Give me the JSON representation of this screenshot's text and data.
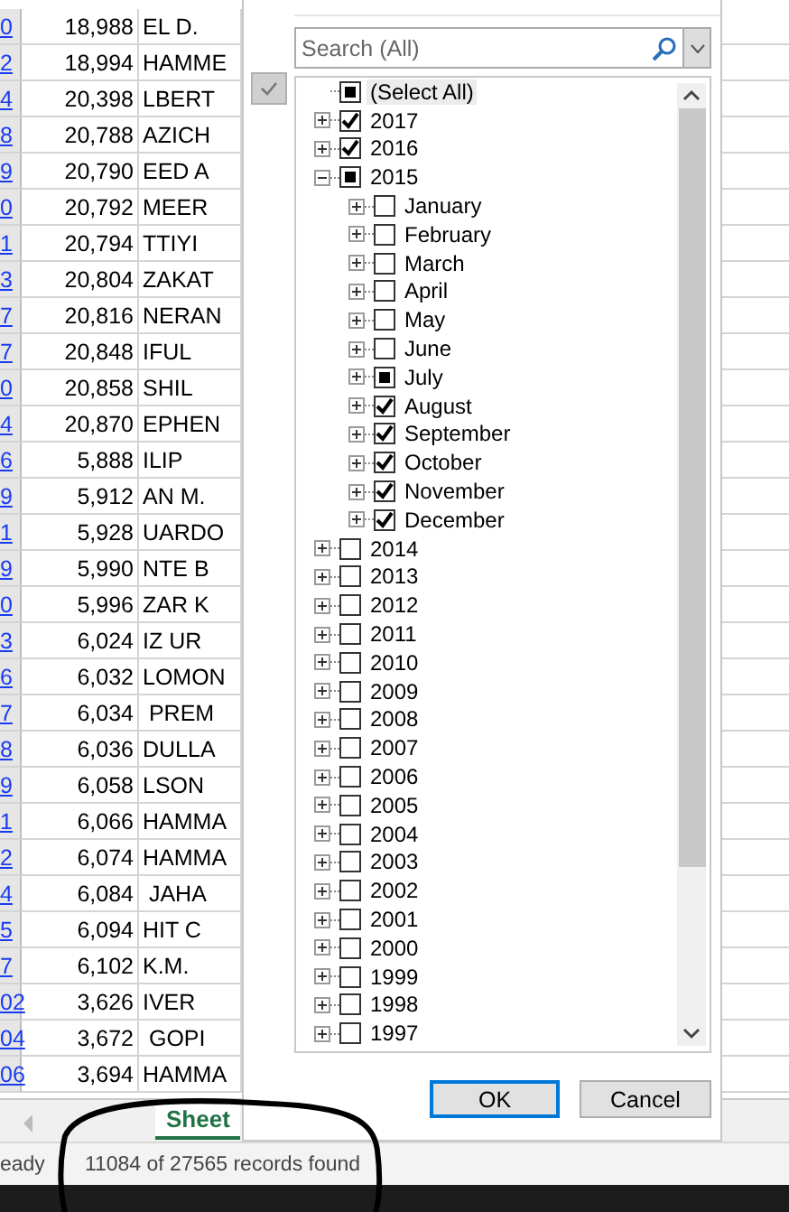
{
  "sheet": {
    "rows": [
      {
        "a": "0",
        "b": "18,988",
        "c": "EL D."
      },
      {
        "a": "2",
        "b": "18,994",
        "c": "HAMME"
      },
      {
        "a": "4",
        "b": "20,398",
        "c": "LBERT"
      },
      {
        "a": "8",
        "b": "20,788",
        "c": "AZICH"
      },
      {
        "a": "9",
        "b": "20,790",
        "c": "EED A"
      },
      {
        "a": "0",
        "b": "20,792",
        "c": "MEER"
      },
      {
        "a": "1",
        "b": "20,794",
        "c": "TTIYI"
      },
      {
        "a": "3",
        "b": "20,804",
        "c": "ZAKAT"
      },
      {
        "a": "7",
        "b": "20,816",
        "c": "NERAN"
      },
      {
        "a": "7",
        "b": "20,848",
        "c": "IFUL"
      },
      {
        "a": "0",
        "b": "20,858",
        "c": "SHIL"
      },
      {
        "a": "4",
        "b": "20,870",
        "c": "EPHEN"
      },
      {
        "a": "6",
        "b": "5,888",
        "c": "ILIP"
      },
      {
        "a": "9",
        "b": "5,912",
        "c": "AN M."
      },
      {
        "a": "1",
        "b": "5,928",
        "c": "UARDO"
      },
      {
        "a": "9",
        "b": "5,990",
        "c": "NTE B"
      },
      {
        "a": "0",
        "b": "5,996",
        "c": "ZAR K"
      },
      {
        "a": "3",
        "b": "6,024",
        "c": "IZ UR"
      },
      {
        "a": "6",
        "b": "6,032",
        "c": "LOMON"
      },
      {
        "a": "7",
        "b": "6,034",
        "c": " PREM"
      },
      {
        "a": "8",
        "b": "6,036",
        "c": "DULLA"
      },
      {
        "a": "9",
        "b": "6,058",
        "c": "LSON"
      },
      {
        "a": "1",
        "b": "6,066",
        "c": "HAMMA"
      },
      {
        "a": "2",
        "b": "6,074",
        "c": "HAMMA"
      },
      {
        "a": "4",
        "b": "6,084",
        "c": " JAHA"
      },
      {
        "a": "5",
        "b": "6,094",
        "c": "HIT C"
      },
      {
        "a": "7",
        "b": "6,102",
        "c": "K.M."
      },
      {
        "a": "02",
        "b": "3,626",
        "c": "IVER"
      },
      {
        "a": "04",
        "b": "3,672",
        "c": " GOPI"
      },
      {
        "a": "06",
        "b": "3,694",
        "c": "HAMMA"
      }
    ],
    "tab": {
      "label": "Sheet",
      "selected": true
    }
  },
  "filter": {
    "search": {
      "placeholder": "Search (All)"
    },
    "tree": [
      {
        "label": "(Select All)",
        "checked": false,
        "partial": true
      },
      {
        "label": "2017",
        "checked": true,
        "partial": false,
        "expanded": false
      },
      {
        "label": "2016",
        "checked": true,
        "partial": false,
        "expanded": false
      },
      {
        "label": "2015",
        "checked": false,
        "partial": true,
        "expanded": true,
        "children": [
          {
            "label": "January",
            "checked": false,
            "partial": false,
            "expanded": false
          },
          {
            "label": "February",
            "checked": false,
            "partial": false,
            "expanded": false
          },
          {
            "label": "March",
            "checked": false,
            "partial": false,
            "expanded": false
          },
          {
            "label": "April",
            "checked": false,
            "partial": false,
            "expanded": false
          },
          {
            "label": "May",
            "checked": false,
            "partial": false,
            "expanded": false
          },
          {
            "label": "June",
            "checked": false,
            "partial": false,
            "expanded": false
          },
          {
            "label": "July",
            "checked": false,
            "partial": true,
            "expanded": false
          },
          {
            "label": "August",
            "checked": true,
            "partial": false,
            "expanded": false
          },
          {
            "label": "September",
            "checked": true,
            "partial": false,
            "expanded": false
          },
          {
            "label": "October",
            "checked": true,
            "partial": false,
            "expanded": false
          },
          {
            "label": "November",
            "checked": true,
            "partial": false,
            "expanded": false
          },
          {
            "label": "December",
            "checked": true,
            "partial": false,
            "expanded": false
          }
        ]
      },
      {
        "label": "2014",
        "checked": false,
        "partial": false,
        "expanded": false
      },
      {
        "label": "2013",
        "checked": false,
        "partial": false,
        "expanded": false
      },
      {
        "label": "2012",
        "checked": false,
        "partial": false,
        "expanded": false
      },
      {
        "label": "2011",
        "checked": false,
        "partial": false,
        "expanded": false
      },
      {
        "label": "2010",
        "checked": false,
        "partial": false,
        "expanded": false
      },
      {
        "label": "2009",
        "checked": false,
        "partial": false,
        "expanded": false
      },
      {
        "label": "2008",
        "checked": false,
        "partial": false,
        "expanded": false
      },
      {
        "label": "2007",
        "checked": false,
        "partial": false,
        "expanded": false
      },
      {
        "label": "2006",
        "checked": false,
        "partial": false,
        "expanded": false
      },
      {
        "label": "2005",
        "checked": false,
        "partial": false,
        "expanded": false
      },
      {
        "label": "2004",
        "checked": false,
        "partial": false,
        "expanded": false
      },
      {
        "label": "2003",
        "checked": false,
        "partial": false,
        "expanded": false
      },
      {
        "label": "2002",
        "checked": false,
        "partial": false,
        "expanded": false
      },
      {
        "label": "2001",
        "checked": false,
        "partial": false,
        "expanded": false
      },
      {
        "label": "2000",
        "checked": false,
        "partial": false,
        "expanded": false
      },
      {
        "label": "1999",
        "checked": false,
        "partial": false,
        "expanded": false
      },
      {
        "label": "1998",
        "checked": false,
        "partial": false,
        "expanded": false
      },
      {
        "label": "1997",
        "checked": false,
        "partial": false,
        "expanded": false
      }
    ],
    "buttons": [
      {
        "label": "OK",
        "kind": "primary"
      },
      {
        "label": "Cancel",
        "kind": "normal"
      }
    ]
  },
  "status_bar": {
    "mode": "eady",
    "message": "11084 of 27565 records found"
  }
}
